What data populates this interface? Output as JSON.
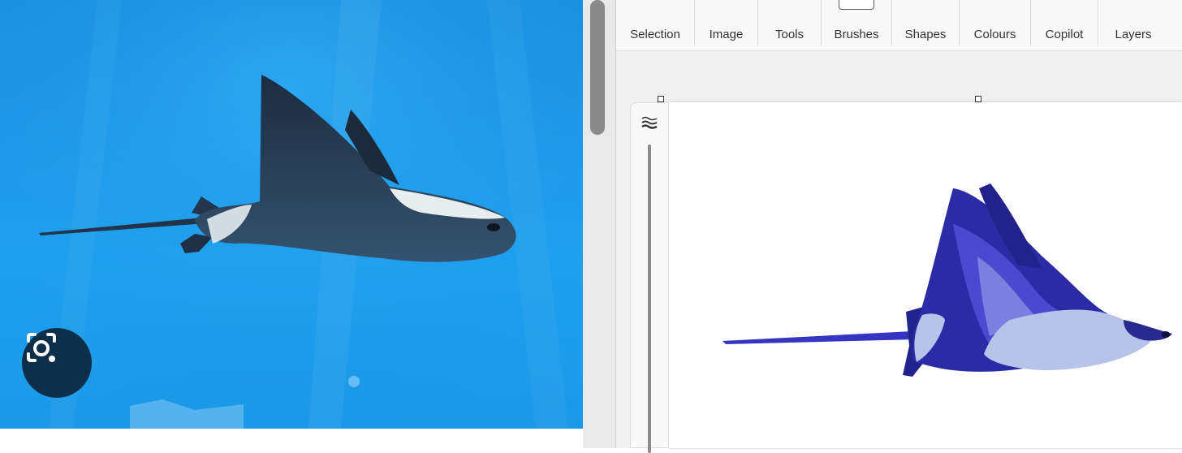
{
  "left_pane": {
    "photo_subject": "eagle-ray-photo",
    "lens_button_icon": "google-lens-icon"
  },
  "paint": {
    "ribbon": {
      "tabs": [
        {
          "label": "Selection"
        },
        {
          "label": "Image"
        },
        {
          "label": "Tools"
        },
        {
          "label": "Brushes"
        },
        {
          "label": "Shapes"
        },
        {
          "label": "Colours"
        },
        {
          "label": "Copilot"
        },
        {
          "label": "Layers"
        }
      ]
    },
    "side_panel": {
      "icon": "brush-size-icon"
    },
    "canvas": {
      "drawing": "eagle-ray-drawing"
    }
  },
  "colors": {
    "water": "#1e9bec",
    "lens_button": "#0d2f49",
    "drawing_dark": "#1f1f8f",
    "drawing_mid": "#4a4ad0",
    "drawing_light": "#b7c4ea"
  }
}
